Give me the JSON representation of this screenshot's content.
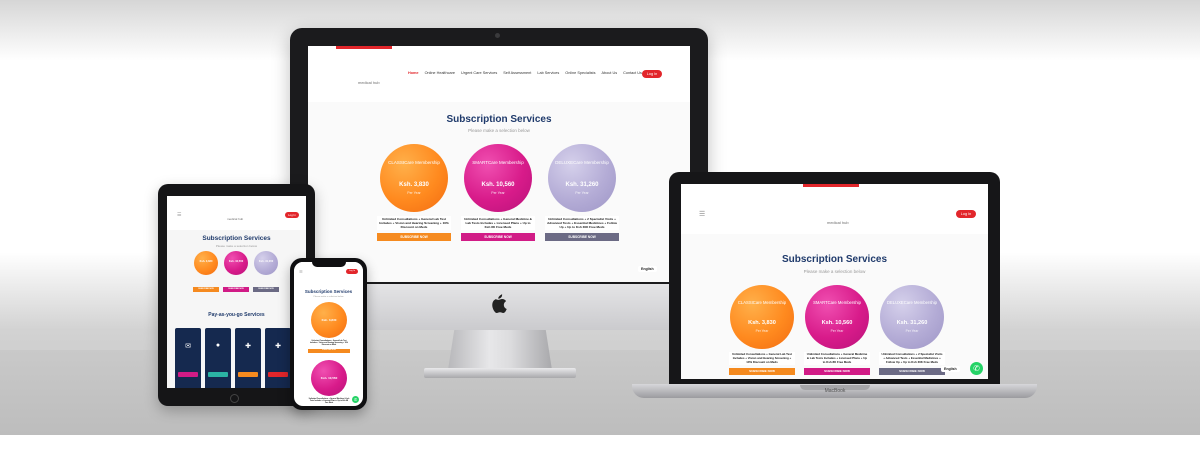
{
  "site": {
    "nav": [
      "Home",
      "Online Healthcare",
      "Urgent Care Services",
      "Self Assessment",
      "Lab Services",
      "Online Specialists",
      "About Us",
      "Contact Us"
    ],
    "login_label": "Log In",
    "logo_text": "medical hub",
    "title": "Subscription Services",
    "subtitle": "Please make a selection below",
    "subscribe_label": "SUBSCRIBE NOW",
    "language_label": "English",
    "services_title": "Pay-as-you-go Services",
    "laptop_brand": "MacBook"
  },
  "plans": [
    {
      "name": "CLASSICare Membership",
      "price": "Ksh. 3,830",
      "period": "Per Year",
      "description": "Unlimited Consultations + General Lab Test Includes + Vision and Hearing Screening + 10% Discount on Meds",
      "color": "#f5821f"
    },
    {
      "name": "SMARTCare Membership",
      "price": "Ksh. 10,560",
      "period": "Per Year",
      "description": "Unlimited Consultations + General Medicine & Lab Tests Includes + Licensed Plans + Up to Ksh 8K Free Meds",
      "color": "#d11b86"
    },
    {
      "name": "DELUXECare Membership",
      "price": "Ksh. 31,260",
      "period": "Per Year",
      "description": "Unlimited Consultations + 2 Specialist Visits + Advanced Tests + Essential Medicines + Follow Up + Up to Ksh 30K Free Meds",
      "color": "#b4acd6"
    }
  ],
  "icons": {
    "apple": "apple-logo-icon",
    "menu": "hamburger-menu-icon",
    "whatsapp": "whatsapp-icon"
  }
}
